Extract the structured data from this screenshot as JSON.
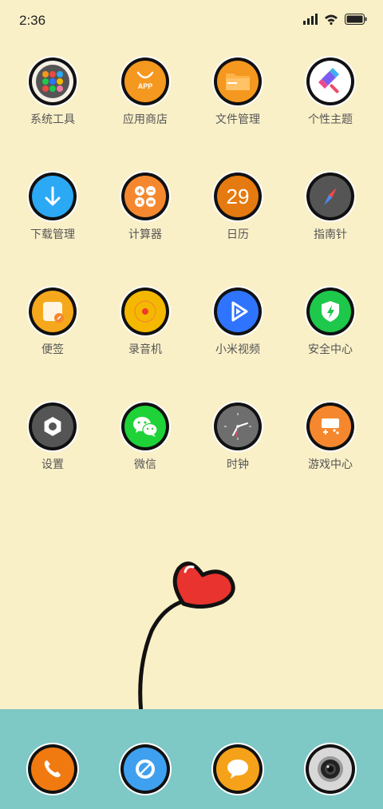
{
  "status_bar": {
    "time": "2:36",
    "icons": [
      "signal-icon",
      "wifi-icon",
      "battery-icon"
    ]
  },
  "apps": [
    {
      "label": "系统工具",
      "icon": "system-tools-icon",
      "color": "#f5f0e6"
    },
    {
      "label": "应用商店",
      "icon": "app-store-icon",
      "color": "#f5981f",
      "badge_text": "APP"
    },
    {
      "label": "文件管理",
      "icon": "file-manager-icon",
      "color": "#f5981f"
    },
    {
      "label": "个性主题",
      "icon": "theme-icon",
      "color": "#ffffff"
    },
    {
      "label": "下载管理",
      "icon": "download-icon",
      "color": "#2ba9f4"
    },
    {
      "label": "计算器",
      "icon": "calculator-icon",
      "color": "#f5882e"
    },
    {
      "label": "日历",
      "icon": "calendar-icon",
      "color": "#e57a10",
      "number": "29"
    },
    {
      "label": "指南针",
      "icon": "compass-icon",
      "color": "#555555"
    },
    {
      "label": "便签",
      "icon": "notes-icon",
      "color": "#f6a81c"
    },
    {
      "label": "录音机",
      "icon": "recorder-icon",
      "color": "#f5b800"
    },
    {
      "label": "小米视频",
      "icon": "video-icon",
      "color": "#2f74ff"
    },
    {
      "label": "安全中心",
      "icon": "security-icon",
      "color": "#1ec84a"
    },
    {
      "label": "设置",
      "icon": "settings-icon",
      "color": "#555555"
    },
    {
      "label": "微信",
      "icon": "wechat-icon",
      "color": "#1ed238"
    },
    {
      "label": "时钟",
      "icon": "clock-icon",
      "color": "#6e6e6e"
    },
    {
      "label": "游戏中心",
      "icon": "game-center-icon",
      "color": "#f5882e"
    }
  ],
  "dock": [
    {
      "icon": "phone-icon",
      "color": "#f07a10"
    },
    {
      "icon": "browser-icon",
      "color": "#3fa0f0"
    },
    {
      "icon": "messages-icon",
      "color": "#f5a21a"
    },
    {
      "icon": "camera-icon",
      "color": "#d8d8d8"
    }
  ],
  "wallpaper": {
    "background": "#faf0c8",
    "dock_color": "#7ec8c6",
    "decoration": "heart-balloon"
  }
}
